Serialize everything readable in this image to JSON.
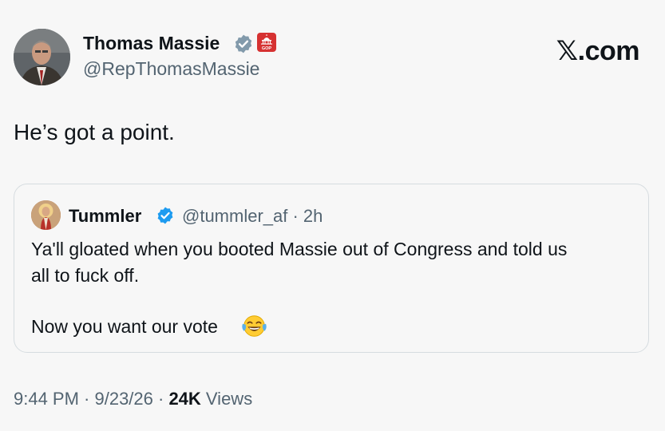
{
  "tweet": {
    "author_name": "Thomas Massie",
    "author_handle": "@RepThomasMassie",
    "text": "He’s got a point.",
    "timestamp": "9:44 PM · 9/23/26 · ",
    "views_count": "24K",
    "views_label": " Views",
    "badge_text": "GOP"
  },
  "brand": "𝕏.com",
  "quoted": {
    "author_name": "Tummler",
    "handle": "@tummler_af",
    "time": " · 2h",
    "line1": "Ya'll gloated when you booted Massie out of Congress and told us",
    "line2": "all to fuck off.",
    "line3": "Now you want our vote"
  },
  "colors": {
    "verified_gray": "#829aab",
    "verified_blue": "#1d9bf0",
    "badge_red": "#d63232",
    "secondary_text": "#536471"
  },
  "icons": {
    "verified_author": "verified-badge-gray",
    "affiliation": "capitol-gop-badge",
    "verified_quoted": "verified-badge-blue",
    "emoji": "face-with-tears-of-joy"
  }
}
